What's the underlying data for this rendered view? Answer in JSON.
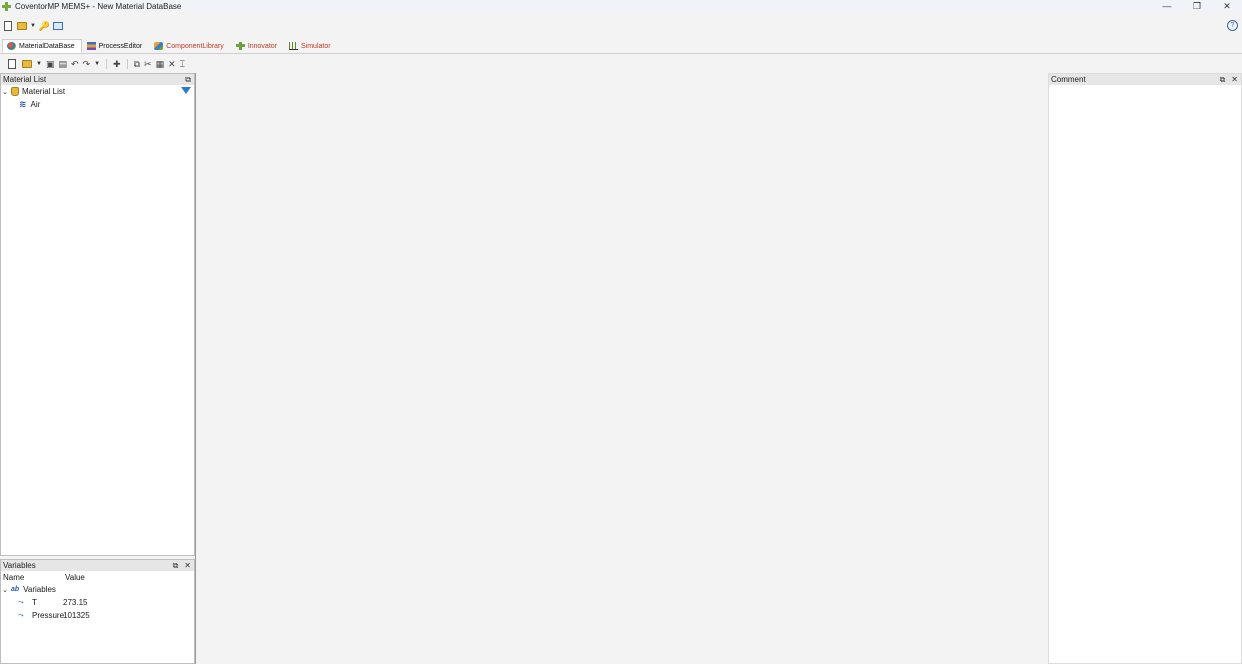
{
  "window": {
    "title": "CoventorMP MEMS+ - New Material DataBase",
    "controls": {
      "minimize": "—",
      "restore": "❐",
      "close": "✕"
    }
  },
  "quick_access": {
    "help": "?"
  },
  "tabs": [
    {
      "label": "MaterialDataBase",
      "icon": "material-db-icon",
      "active": true
    },
    {
      "label": "ProcessEditor",
      "icon": "process-editor-icon"
    },
    {
      "label": "ComponentLibrary",
      "icon": "component-library-icon"
    },
    {
      "label": "Innovator",
      "icon": "innovator-icon"
    },
    {
      "label": "Simulator",
      "icon": "simulator-icon"
    }
  ],
  "material_panel": {
    "title": "Material List",
    "tree": {
      "root": "Material List",
      "items": [
        "Air"
      ]
    }
  },
  "variables_panel": {
    "title": "Variables",
    "columns": {
      "name": "Name",
      "value": "Value"
    },
    "group": "Variables",
    "group_icon_text": "ab",
    "rows": [
      {
        "name": "T",
        "value": "273.15"
      },
      {
        "name": "Pressure",
        "value": "101325"
      }
    ]
  },
  "comment_panel": {
    "title": "Comment"
  },
  "colors": {
    "accent": "#2d7bd0",
    "tab_red": "#c23b22",
    "panel_header": "#e6e6e6"
  }
}
